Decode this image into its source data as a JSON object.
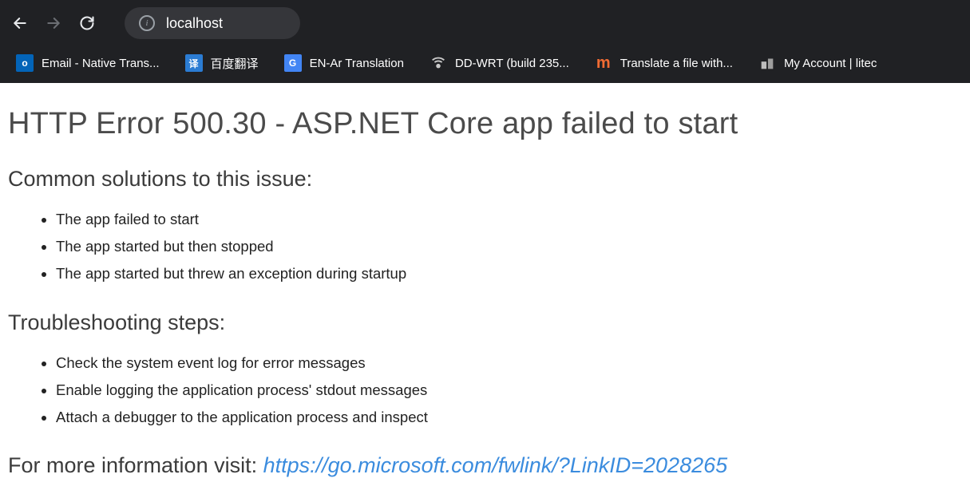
{
  "browser": {
    "url": "localhost"
  },
  "bookmarks": [
    {
      "label": "Email - Native Trans...",
      "icon_name": "outlook"
    },
    {
      "label": "百度翻译",
      "icon_name": "baidu"
    },
    {
      "label": "EN-Ar Translation",
      "icon_name": "gtranslate"
    },
    {
      "label": "DD-WRT (build 235...",
      "icon_name": "ddwrt"
    },
    {
      "label": "Translate a file with...",
      "icon_name": "matecat"
    },
    {
      "label": "My Account | litec",
      "icon_name": "litecoin"
    }
  ],
  "page": {
    "title": "HTTP Error 500.30 - ASP.NET Core app failed to start",
    "solutions_heading": "Common solutions to this issue:",
    "solutions": [
      "The app failed to start",
      "The app started but then stopped",
      "The app started but threw an exception during startup"
    ],
    "troubleshooting_heading": "Troubleshooting steps:",
    "troubleshooting": [
      "Check the system event log for error messages",
      "Enable logging the application process' stdout messages",
      "Attach a debugger to the application process and inspect"
    ],
    "more_info_prefix": "For more information visit: ",
    "more_info_link_text": "https://go.microsoft.com/fwlink/?LinkID=2028265"
  }
}
